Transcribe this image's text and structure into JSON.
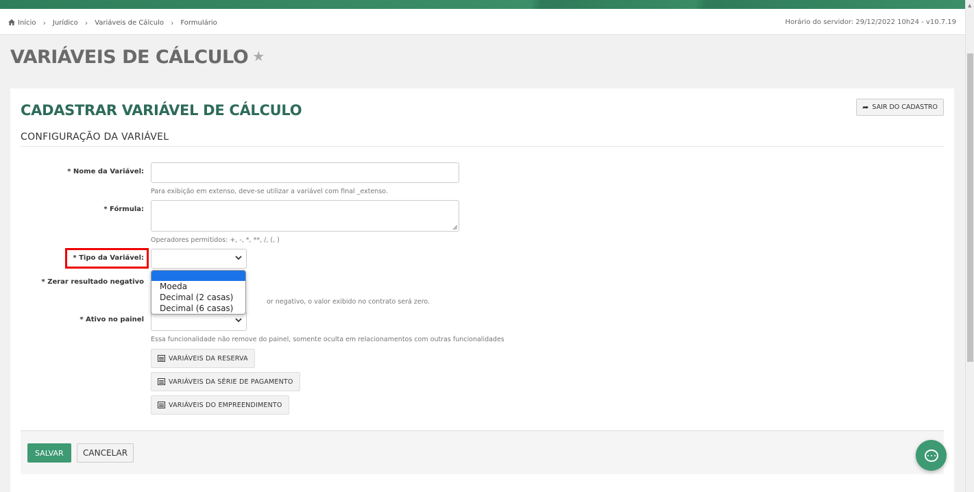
{
  "breadcrumb": {
    "items": [
      "Início",
      "Jurídico",
      "Variáveis de Cálculo",
      "Formulário"
    ],
    "server_time": "Horário do servidor: 29/12/2022 10h24 - v10.7.19"
  },
  "page": {
    "title": "VARIÁVEIS DE CÁLCULO"
  },
  "panel": {
    "title": "CADASTRAR VARIÁVEL DE CÁLCULO",
    "exit_label": "SAIR DO CADASTRO",
    "section_title": "CONFIGURAÇÃO DA VARIÁVEL"
  },
  "form": {
    "nome_label": "* Nome da Variável:",
    "nome_value": "",
    "nome_help": "Para exibição em extenso, deve-se utilizar a variável com final _extenso.",
    "formula_label": "* Fórmula:",
    "formula_value": "",
    "formula_help": "Operadores permitidos: +, -, *, **, /, (, )",
    "tipo_label": "* Tipo da Variável:",
    "tipo_options": [
      "",
      "Moeda",
      "Decimal (2 casas)",
      "Decimal (6 casas)"
    ],
    "zerar_label": "* Zerar resultado negativo",
    "zerar_help": "or negativo, o valor exibido no contrato será zero.",
    "ativo_label": "* Ativo no painel",
    "ativo_help": "Essa funcionalidade não remove do painel, somente oculta em relacionamentos com outras funcionalidades"
  },
  "buttons": {
    "reserva": "VARIÁVEIS DA RESERVA",
    "serie": "VARIÁVEIS DA SÉRIE DE PAGAMENTO",
    "empreendimento": "VARIÁVEIS DO EMPREENDIMENTO",
    "save": "SALVAR",
    "cancel": "CANCELAR"
  },
  "colors": {
    "brand": "#3d9a72",
    "title": "#2e6b5a",
    "highlight": "#e00000",
    "dropdown_selected": "#1a73e8"
  }
}
